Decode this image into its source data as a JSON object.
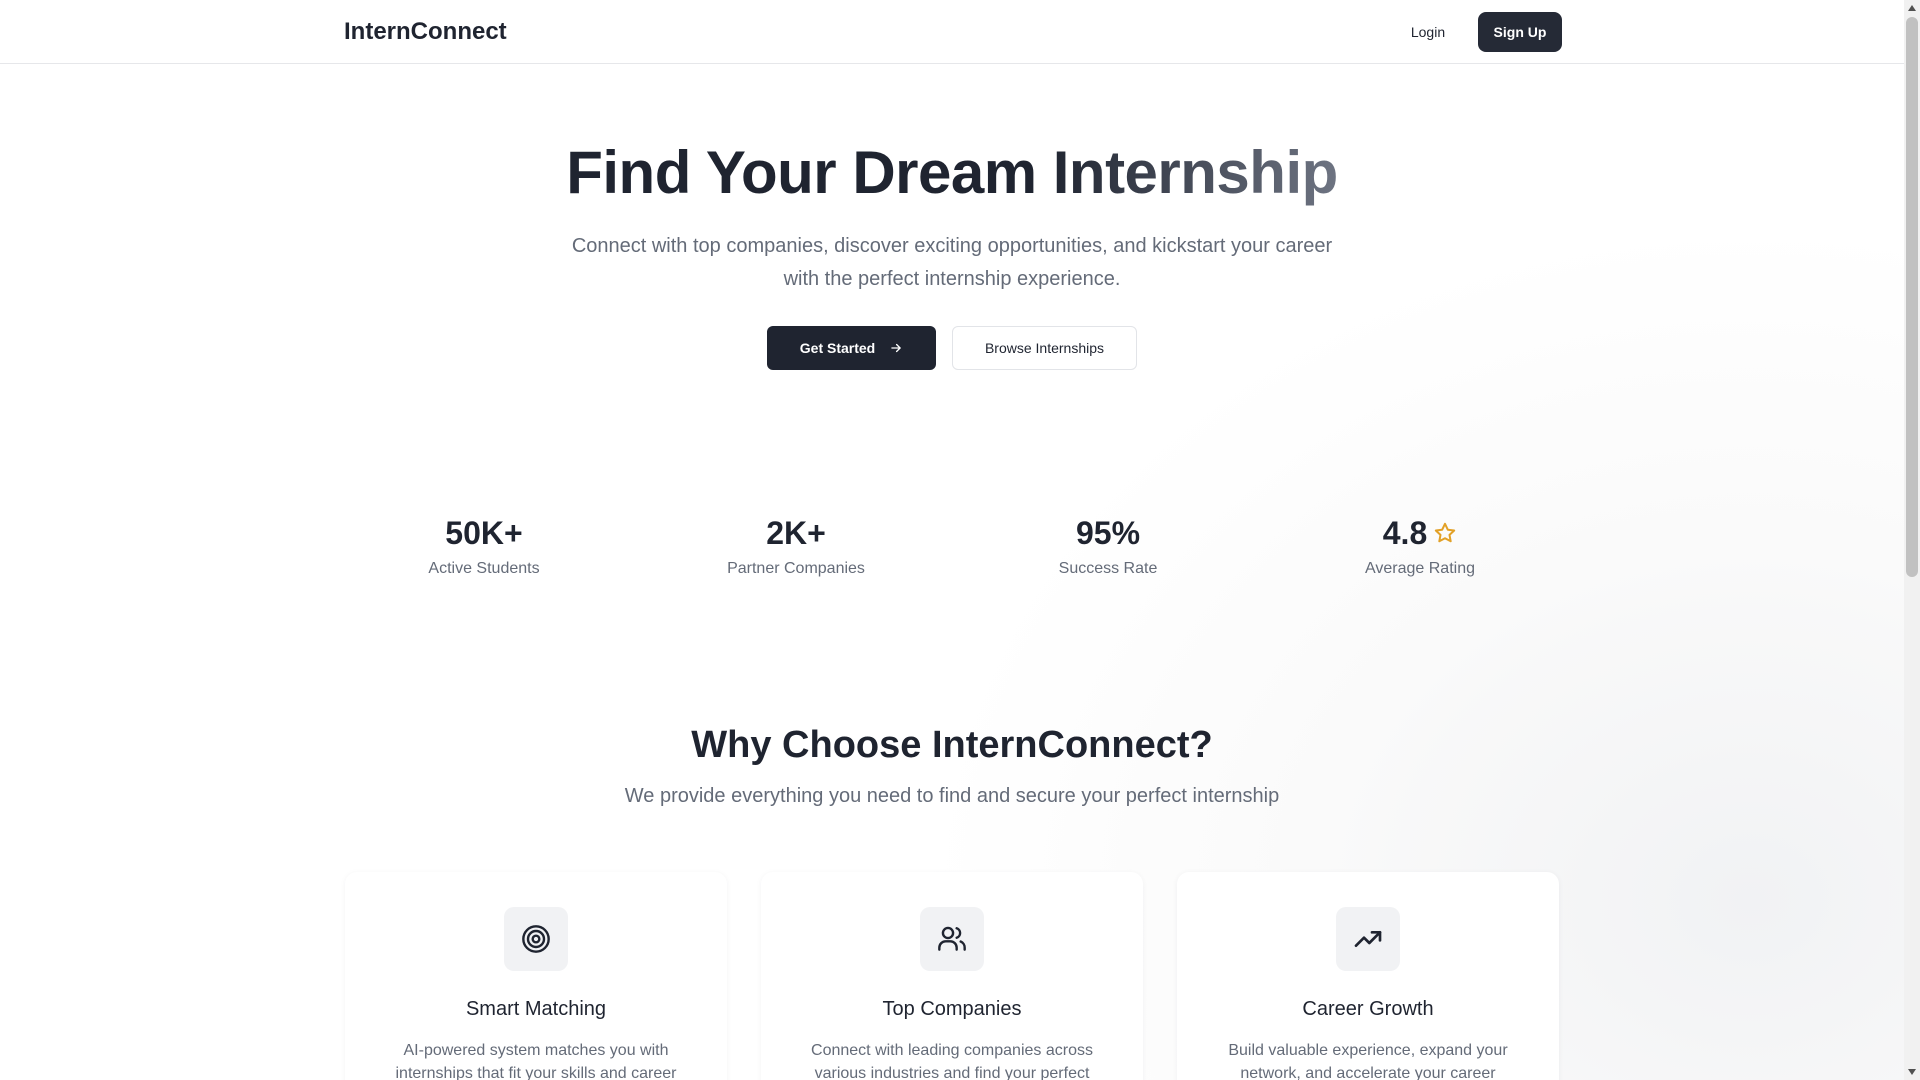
{
  "header": {
    "brand": "InternConnect",
    "login_label": "Login",
    "signup_label": "Sign Up"
  },
  "hero": {
    "title": "Find Your Dream Internship",
    "subtitle": "Connect with top companies, discover exciting opportunities, and kickstart your career with the perfect internship experience.",
    "primary_cta": "Get Started",
    "secondary_cta": "Browse Internships"
  },
  "stats": [
    {
      "value": "50K+",
      "label": "Active Students"
    },
    {
      "value": "2K+",
      "label": "Partner Companies"
    },
    {
      "value": "95%",
      "label": "Success Rate"
    },
    {
      "value": "4.8",
      "label": "Average Rating",
      "icon": "star-icon",
      "icon_color": "#e2a127"
    }
  ],
  "why": {
    "title": "Why Choose InternConnect?",
    "subtitle": "We provide everything you need to find and secure your perfect internship"
  },
  "features": [
    {
      "icon": "target-icon",
      "title": "Smart Matching",
      "description": "AI-powered system matches you with internships that fit your skills and career"
    },
    {
      "icon": "users-icon",
      "title": "Top Companies",
      "description": "Connect with leading companies across various industries and find your perfect"
    },
    {
      "icon": "trending-up-icon",
      "title": "Career Growth",
      "description": "Build valuable experience, expand your network, and accelerate your career"
    }
  ],
  "colors": {
    "primary": "#1f2430",
    "muted_text": "#646b78",
    "star": "#e2a127"
  }
}
